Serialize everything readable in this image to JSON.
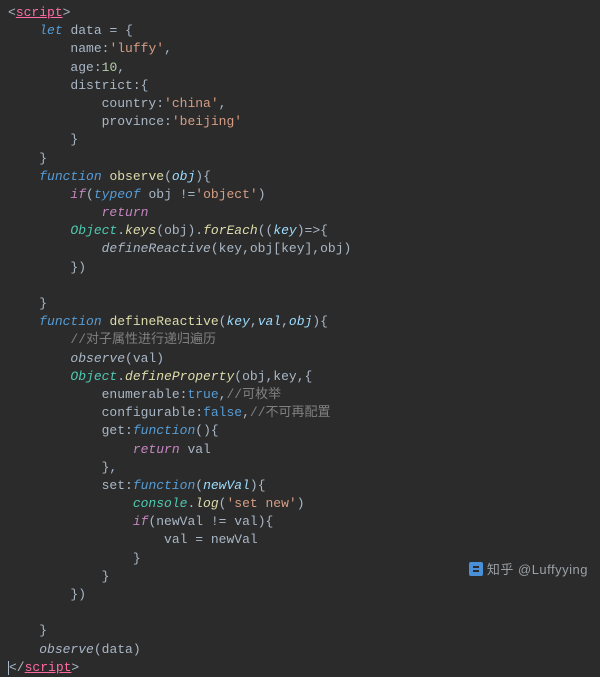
{
  "watermark": {
    "text": "知乎 @Luffyying"
  },
  "code": {
    "tag": "script",
    "var_decl": {
      "kw": "let",
      "name": "data"
    },
    "props": {
      "name_key": "name",
      "name_val": "'luffy'",
      "age_key": "age",
      "age_val": "10",
      "district_key": "district",
      "country_key": "country",
      "country_val": "'china'",
      "province_key": "province",
      "province_val": "'beijing'"
    },
    "fn_observe": {
      "kw": "function",
      "name": "observe",
      "param": "obj",
      "typeof_kw": "typeof",
      "if_kw": "if",
      "neq": "!=",
      "obj_str": "'object'",
      "return_kw": "return",
      "object_global": "Object",
      "keys": "keys",
      "foreach": "forEach",
      "arrow_param": "key",
      "call": "defineReactive",
      "arg1": "key",
      "arg2_obj": "obj",
      "arg2_key": "key",
      "arg3": "obj"
    },
    "fn_define": {
      "kw": "function",
      "name": "defineReactive",
      "p1": "key",
      "p2": "val",
      "p3": "obj",
      "comment1": "//对子属性进行递归遍历",
      "observe_call": "observe",
      "observe_arg": "val",
      "object_global": "Object",
      "defineProperty": "defineProperty",
      "dp_arg1": "obj",
      "dp_arg2": "key",
      "enum_key": "enumerable",
      "enum_val": "true",
      "enum_comment": "//可枚举",
      "conf_key": "configurable",
      "conf_val": "false",
      "conf_comment": "//不可再配置",
      "get_key": "get",
      "get_fn": "function",
      "get_ret": "return",
      "get_val": "val",
      "set_key": "set",
      "set_fn": "function",
      "set_param": "newVal",
      "console": "console",
      "log": "log",
      "log_str": "'set new'",
      "if_kw": "if",
      "cmp_l": "newVal",
      "neq": "!=",
      "cmp_r": "val",
      "assign_l": "val",
      "assign_r": "newVal"
    },
    "final_call": {
      "fn": "observe",
      "arg": "data"
    }
  }
}
